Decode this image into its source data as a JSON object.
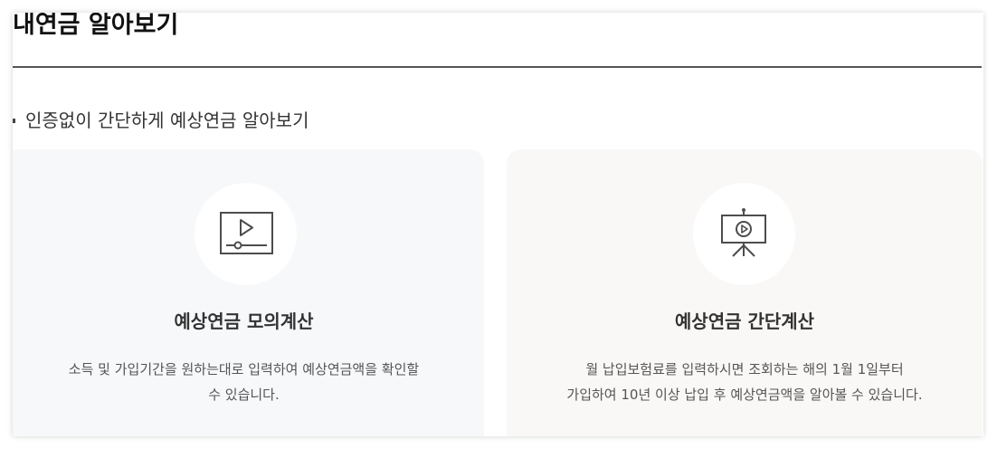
{
  "page": {
    "title": "내연금 알아보기",
    "section_heading": "인증없이 간단하게 예상연금 알아보기"
  },
  "cards": [
    {
      "icon": "video-player-icon",
      "title": "예상연금 모의계산",
      "desc_line1": "소득 및 가입기간을 원하는대로 입력하여 예상연금액을 확인할",
      "desc_line2": "수 있습니다."
    },
    {
      "icon": "presentation-play-icon",
      "title": "예상연금 간단계산",
      "desc_line1": "월 납입보험료를 입력하시면 조회하는 해의 1월 1일부터",
      "desc_line2": "가입하여 10년 이상 납입 후 예상연금액을 알아볼 수 있습니다."
    }
  ],
  "colors": {
    "card_left_bg": "#f7f8fa",
    "card_right_bg": "#f9f8f6",
    "title_text": "#111111",
    "body_text": "#555555",
    "rule": "#555555"
  }
}
